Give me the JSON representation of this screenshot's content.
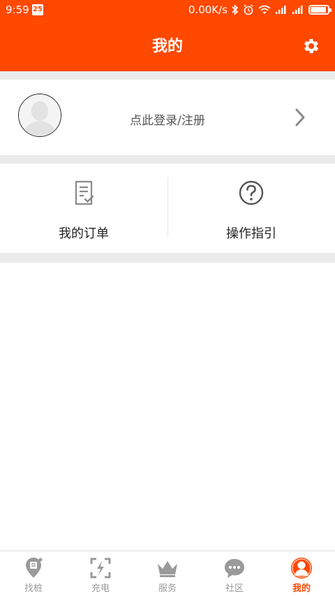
{
  "status_bar": {
    "time": "9:59",
    "date_icon": "25",
    "network_speed": "0.00K/s",
    "icons": [
      "bluetooth-icon",
      "alarm-icon",
      "wifi-icon",
      "signal-icon",
      "signal-icon",
      "battery-icon"
    ],
    "battery_level": 0.9
  },
  "header": {
    "title": "我的",
    "settings_icon": "gear-icon",
    "background_color": "#ff4800"
  },
  "profile": {
    "avatar_icon": "default-avatar-icon",
    "login_text": "点此登录/注册",
    "chevron_icon": "chevron-right-icon"
  },
  "quick_actions": [
    {
      "label": "我的订单",
      "icon": "order-document-icon"
    },
    {
      "label": "操作指引",
      "icon": "question-circle-icon"
    }
  ],
  "tab_bar": {
    "active_color": "#ff4800",
    "inactive_color": "#9a9a9a",
    "tabs": [
      {
        "label": "找桩",
        "icon": "location-pin-icon",
        "active": false
      },
      {
        "label": "充电",
        "icon": "charge-scan-icon",
        "active": false
      },
      {
        "label": "服务",
        "icon": "crown-icon",
        "active": false
      },
      {
        "label": "社区",
        "icon": "chat-bubble-icon",
        "active": false
      },
      {
        "label": "我的",
        "icon": "user-profile-icon",
        "active": true
      }
    ]
  }
}
